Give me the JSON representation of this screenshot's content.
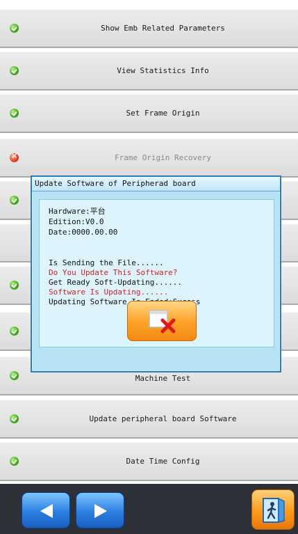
{
  "menu": {
    "items": [
      {
        "label": "Show Emb Related Parameters",
        "status": "ok"
      },
      {
        "label": "View Statistics Info",
        "status": "ok"
      },
      {
        "label": "Set Frame Origin",
        "status": "ok"
      },
      {
        "label": "Frame Origin Recovery",
        "status": "error"
      },
      {
        "label": "",
        "status": "ok"
      },
      {
        "label": "",
        "status": "none"
      },
      {
        "label": "",
        "status": "ok"
      },
      {
        "label": "",
        "status": "ok"
      },
      {
        "label": "Machine Test",
        "status": "ok"
      },
      {
        "label": "Update peripheral board Software",
        "status": "ok"
      },
      {
        "label": "Date Time Config",
        "status": "ok"
      }
    ]
  },
  "dialog": {
    "title": "Update Software of Peripherad board",
    "hardware": "Hardware:平台",
    "edition": "Edition:V0.0",
    "date": "Date:0000.00.00",
    "status_lines": [
      {
        "text": "Is Sending the File......",
        "color": "#111111"
      },
      {
        "text": "Do You Update This Software?",
        "color": "#d42020"
      },
      {
        "text": "Get Ready Soft-Updating......",
        "color": "#111111"
      },
      {
        "text": "Software Is Updating......",
        "color": "#d42020"
      },
      {
        "text": "Updating Software Is Ended:Sucess",
        "color": "#111111"
      }
    ],
    "close_icon": "close-window-icon"
  },
  "bottom_bar": {
    "prev_icon": "arrow-left-icon",
    "next_icon": "arrow-right-icon",
    "exit_icon": "exit-door-icon"
  },
  "colors": {
    "accent": "#2b7fe0",
    "warning": "#ff9b1a",
    "ok": "#3fa81f",
    "error": "#e0401e",
    "dialog_bg": "#b7e3f5"
  }
}
